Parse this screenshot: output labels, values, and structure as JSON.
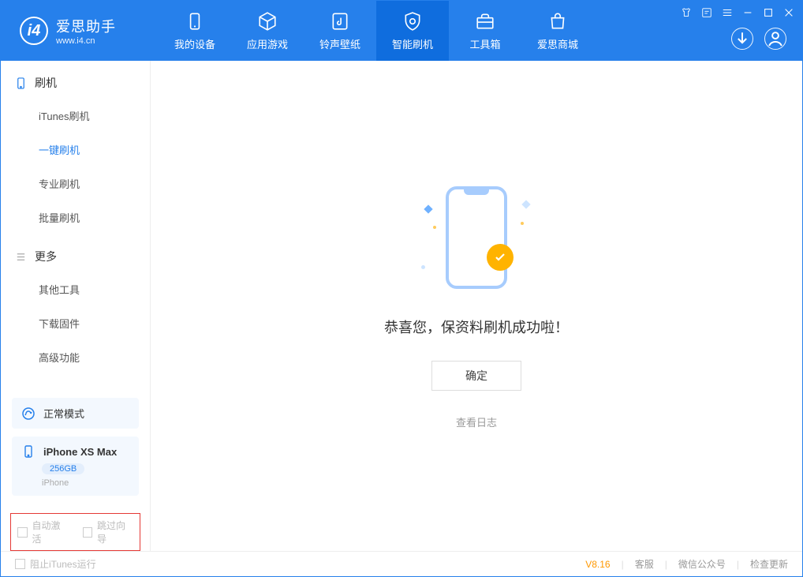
{
  "app": {
    "title": "爱思助手",
    "subtitle": "www.i4.cn"
  },
  "tabs": [
    {
      "label": "我的设备"
    },
    {
      "label": "应用游戏"
    },
    {
      "label": "铃声壁纸"
    },
    {
      "label": "智能刷机"
    },
    {
      "label": "工具箱"
    },
    {
      "label": "爱思商城"
    }
  ],
  "sidebar": {
    "section_flash": "刷机",
    "items_flash": [
      {
        "label": "iTunes刷机"
      },
      {
        "label": "一键刷机"
      },
      {
        "label": "专业刷机"
      },
      {
        "label": "批量刷机"
      }
    ],
    "section_more": "更多",
    "items_more": [
      {
        "label": "其他工具"
      },
      {
        "label": "下载固件"
      },
      {
        "label": "高级功能"
      }
    ],
    "mode": "正常模式",
    "device": {
      "name": "iPhone XS Max",
      "capacity": "256GB",
      "type": "iPhone"
    },
    "checkboxes": {
      "auto_activate": "自动激活",
      "skip_guide": "跳过向导"
    }
  },
  "main": {
    "success_message": "恭喜您，保资料刷机成功啦！",
    "ok_button": "确定",
    "view_log": "查看日志"
  },
  "footer": {
    "block_itunes": "阻止iTunes运行",
    "version": "V8.16",
    "support": "客服",
    "wechat": "微信公众号",
    "check_update": "检查更新"
  }
}
